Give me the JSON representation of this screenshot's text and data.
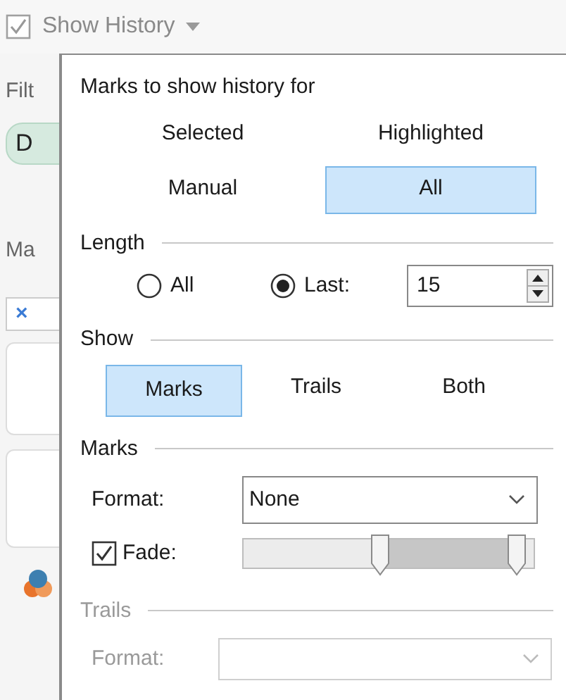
{
  "toolbar": {
    "label": "Show History",
    "checked": true
  },
  "background": {
    "filter_label": "Filt",
    "pill": "D",
    "marks_label": "Ma",
    "field_text": "×"
  },
  "marks_to_show": {
    "title": "Marks to show history for",
    "options": [
      {
        "label": "Selected",
        "selected": false
      },
      {
        "label": "Highlighted",
        "selected": false
      },
      {
        "label": "Manual",
        "selected": false
      },
      {
        "label": "All",
        "selected": true
      }
    ]
  },
  "length": {
    "title": "Length",
    "options": [
      {
        "label": "All",
        "selected": false
      },
      {
        "label": "Last:",
        "selected": true
      }
    ],
    "count": "15"
  },
  "show": {
    "title": "Show",
    "options": [
      {
        "label": "Marks",
        "selected": true
      },
      {
        "label": "Trails",
        "selected": false
      },
      {
        "label": "Both",
        "selected": false
      }
    ]
  },
  "marks": {
    "title": "Marks",
    "format_label": "Format:",
    "format_value": "None",
    "fade": {
      "label": "Fade:",
      "checked": true,
      "thumbs": [
        {
          "level": 0.47
        },
        {
          "level": 0.94
        }
      ]
    }
  },
  "trails": {
    "title": "Trails",
    "disabled": true,
    "format_label": "Format:"
  }
}
